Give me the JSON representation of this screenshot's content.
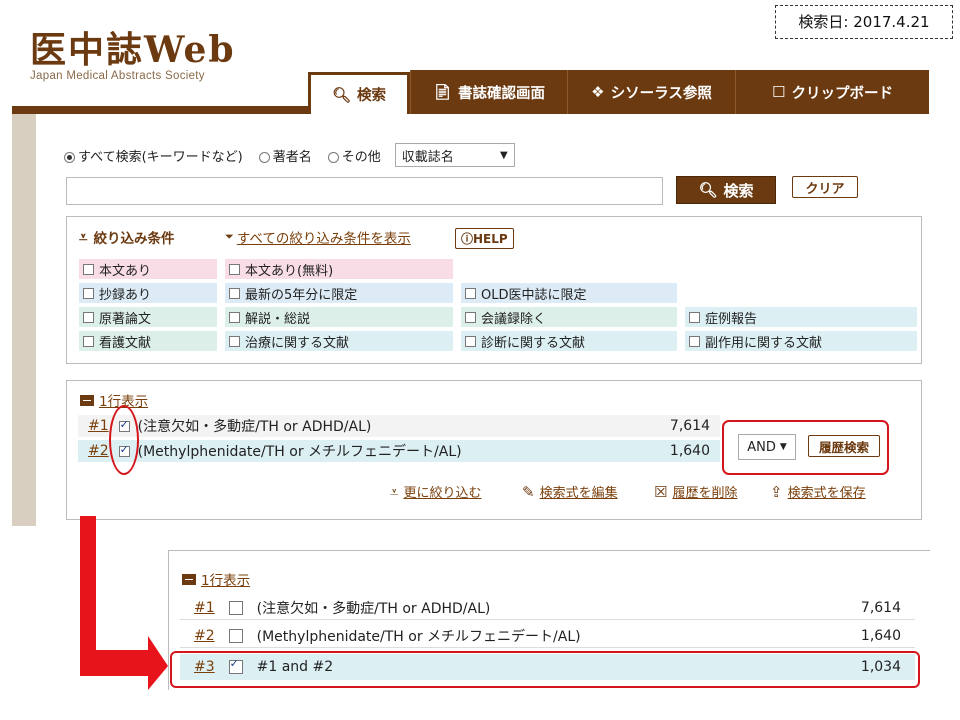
{
  "search_date": "検索日: 2017.4.21",
  "logo": {
    "title": "医中誌Web",
    "subtitle": "Japan Medical Abstracts Society"
  },
  "tabs": [
    {
      "label": "検索",
      "icon": "search-icon",
      "active": true
    },
    {
      "label": "書誌確認画面",
      "icon": "document-icon",
      "active": false
    },
    {
      "label": "シソーラス参照",
      "icon": "thesaurus-icon",
      "active": false
    },
    {
      "label": "クリップボード",
      "icon": "clipboard-icon",
      "active": false
    }
  ],
  "search_mode": {
    "options": [
      "すべて検索(キーワードなど)",
      "著者名",
      "その他"
    ],
    "selected": "すべて検索(キーワードなど)",
    "select_value": "収載誌名"
  },
  "search": {
    "input_value": "",
    "search_label": "検索",
    "clear_label": "クリア"
  },
  "filters": {
    "title": "絞り込み条件",
    "show_all": "すべての絞り込み条件を表示",
    "help": "HELP",
    "items": [
      "本文あり",
      "本文あり(無料)",
      "抄録あり",
      "最新の5年分に限定",
      "OLD医中誌に限定",
      "原著論文",
      "解説・総説",
      "会議録除く",
      "症例報告",
      "看護文献",
      "治療に関する文献",
      "診断に関する文献",
      "副作用に関する文献"
    ]
  },
  "history": {
    "toggle": "1行表示",
    "rows": [
      {
        "num": "#1",
        "query": "(注意欠如・多動症/TH or ADHD/AL)",
        "count": "7,614",
        "checked": true
      },
      {
        "num": "#2",
        "query": "(Methylphenidate/TH or メチルフェニデート/AL)",
        "count": "1,640",
        "checked": true
      }
    ],
    "operator": "AND",
    "history_search": "履歴検索",
    "actions": [
      {
        "label": "更に絞り込む",
        "icon": "filter-icon"
      },
      {
        "label": "検索式を編集",
        "icon": "edit-icon"
      },
      {
        "label": "履歴を削除",
        "icon": "delete-icon"
      },
      {
        "label": "検索式を保存",
        "icon": "save-icon"
      }
    ]
  },
  "result": {
    "toggle": "1行表示",
    "rows": [
      {
        "num": "#1",
        "query": "(注意欠如・多動症/TH or ADHD/AL)",
        "count": "7,614",
        "checked": false
      },
      {
        "num": "#2",
        "query": "(Methylphenidate/TH or メチルフェニデート/AL)",
        "count": "1,640",
        "checked": false
      },
      {
        "num": "#3",
        "query": "#1 and #2",
        "count": "1,034",
        "checked": true
      }
    ]
  },
  "colors": {
    "brand": "#6b3a10",
    "highlight": "#d4161c",
    "row_teal": "#dcf0f4"
  }
}
